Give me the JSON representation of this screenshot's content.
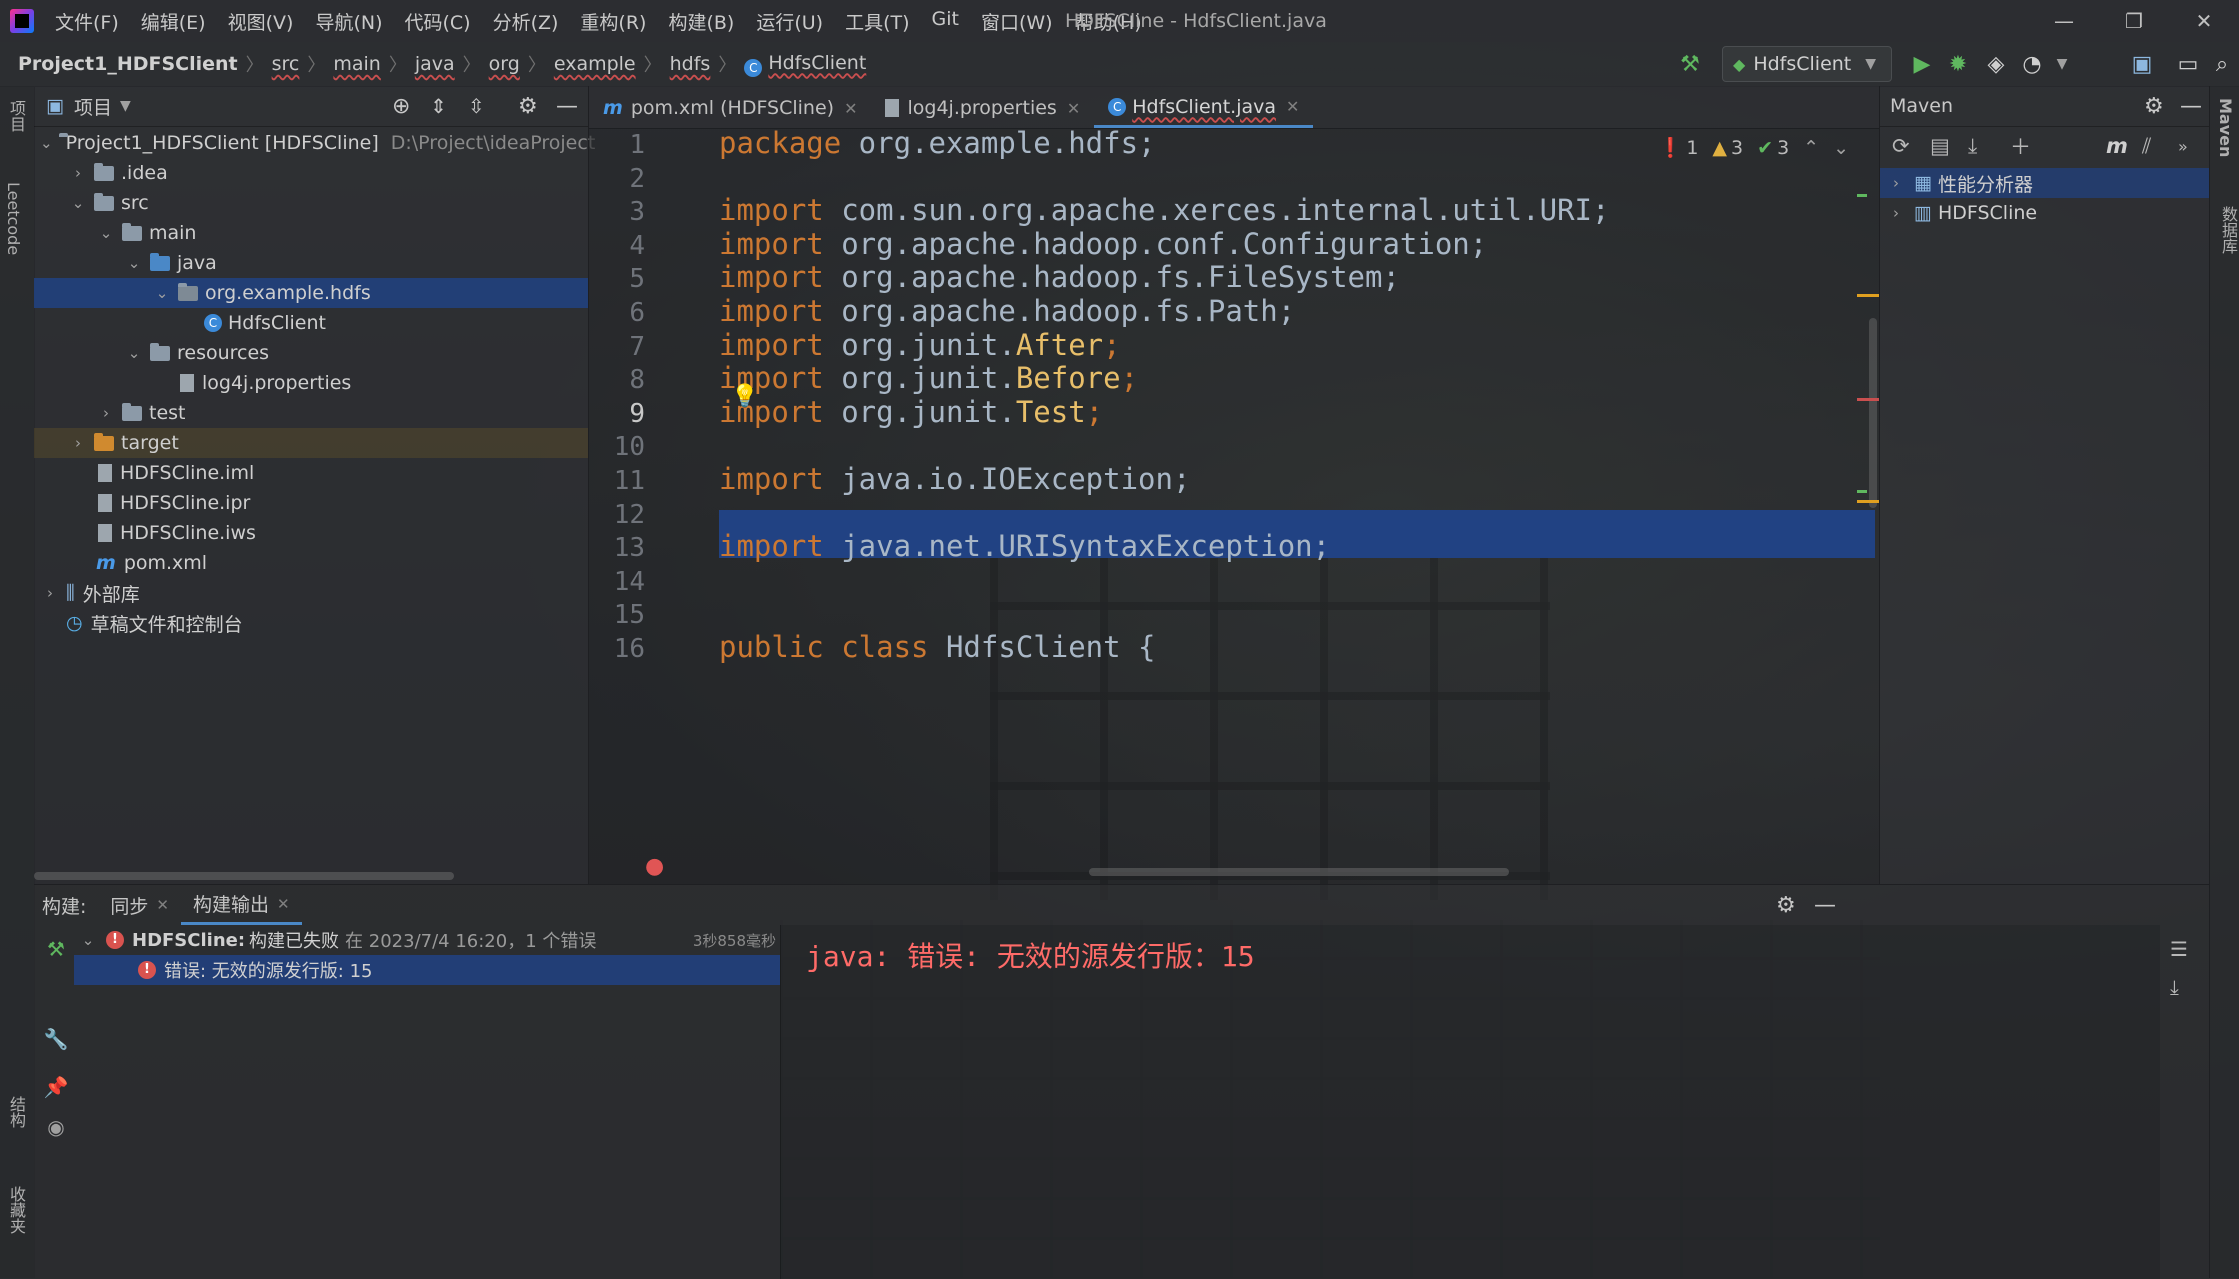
{
  "window": {
    "title": "HDFSCline - HdfsClient.java",
    "menu": [
      "文件(F)",
      "编辑(E)",
      "视图(V)",
      "导航(N)",
      "代码(C)",
      "分析(Z)",
      "重构(R)",
      "构建(B)",
      "运行(U)",
      "工具(T)",
      "Git",
      "窗口(W)",
      "帮助(H)"
    ],
    "controls": {
      "minimize": "—",
      "restore": "❐",
      "close": "✕"
    }
  },
  "breadcrumb": {
    "project": "Project1_HDFSClient",
    "parts": [
      "src",
      "main",
      "java",
      "org",
      "example",
      "hdfs"
    ],
    "file": "HdfsClient"
  },
  "run_config": {
    "label": "HdfsClient"
  },
  "left_strip": {
    "project_label": "项目",
    "leetcode_label": "Leetcode",
    "structure_label": "结构",
    "favorites_label": "收藏夹"
  },
  "project_panel": {
    "title": "项目",
    "tree": [
      {
        "label": "Project1_HDFSClient [HDFSCline]",
        "hint": "D:\\Project\\ideaProject"
      },
      {
        "label": ".idea"
      },
      {
        "label": "src"
      },
      {
        "label": "main"
      },
      {
        "label": "java"
      },
      {
        "label": "org.example.hdfs"
      },
      {
        "label": "HdfsClient"
      },
      {
        "label": "resources"
      },
      {
        "label": "log4j.properties"
      },
      {
        "label": "test"
      },
      {
        "label": "target"
      },
      {
        "label": "HDFSCline.iml"
      },
      {
        "label": "HDFSCline.ipr"
      },
      {
        "label": "HDFSCline.iws"
      },
      {
        "label": "pom.xml"
      },
      {
        "label": "外部库"
      },
      {
        "label": "草稿文件和控制台"
      }
    ]
  },
  "editor": {
    "tabs": [
      {
        "label": "pom.xml (HDFSCline)"
      },
      {
        "label": "log4j.properties"
      },
      {
        "label": "HdfsClient.java"
      }
    ],
    "inspections": {
      "errors": "1",
      "warnings": "3",
      "ok": "3"
    },
    "line_numbers": [
      "1",
      "2",
      "3",
      "4",
      "5",
      "6",
      "7",
      "8",
      "9",
      "10",
      "11",
      "12",
      "13",
      "14",
      "15",
      "16"
    ],
    "current_line": "9",
    "lines": [
      {
        "kw": "package",
        "rest": " org.example.hdfs;"
      },
      {
        "kw": "",
        "rest": ""
      },
      {
        "kw": "import",
        "rest": " com.sun.org.apache.xerces.internal.util.URI;"
      },
      {
        "kw": "import",
        "rest": " org.apache.hadoop.conf.Configuration;"
      },
      {
        "kw": "import",
        "rest": " org.apache.hadoop.fs.FileSystem;"
      },
      {
        "kw": "import",
        "rest": " org.apache.hadoop.fs.Path;"
      },
      {
        "kw": "import",
        "rest": " org.junit.",
        "yl": "After",
        "end": ";"
      },
      {
        "kw": "import",
        "rest": " org.junit.",
        "yl": "Before",
        "end": ";"
      },
      {
        "kw": "import",
        "rest": " org.junit.",
        "yl": "Test",
        "end": ";"
      },
      {
        "kw": "",
        "rest": ""
      },
      {
        "kw": "import",
        "rest": " java.io.IOException;"
      },
      {
        "kw": "",
        "rest": ""
      },
      {
        "kw": "import",
        "rest": " java.net.URISyntaxException;"
      },
      {
        "kw": "",
        "rest": ""
      },
      {
        "kw": "",
        "rest": ""
      },
      {
        "kw": "public class",
        "rest": " HdfsClient {"
      }
    ]
  },
  "maven": {
    "title": "Maven",
    "items": [
      {
        "label": "性能分析器"
      },
      {
        "label": "HDFSCline"
      }
    ],
    "side_label": "Maven",
    "db_label": "数据库"
  },
  "build": {
    "tabs": [
      {
        "label": "构建:"
      },
      {
        "label": "同步"
      },
      {
        "label": "构建输出"
      }
    ],
    "root": {
      "project": "HDFSCline:",
      "status": "构建已失败",
      "meta": "在 2023/7/4 16:20，1 个错误",
      "duration": "3秒858毫秒"
    },
    "error_item": "错误: 无效的源发行版: 15",
    "output": "java: 错误: 无效的源发行版：15"
  },
  "colors": {
    "accent": "#4a88c7",
    "selection": "#214283",
    "keyword": "#cc7832",
    "error": "#ff6b68"
  }
}
